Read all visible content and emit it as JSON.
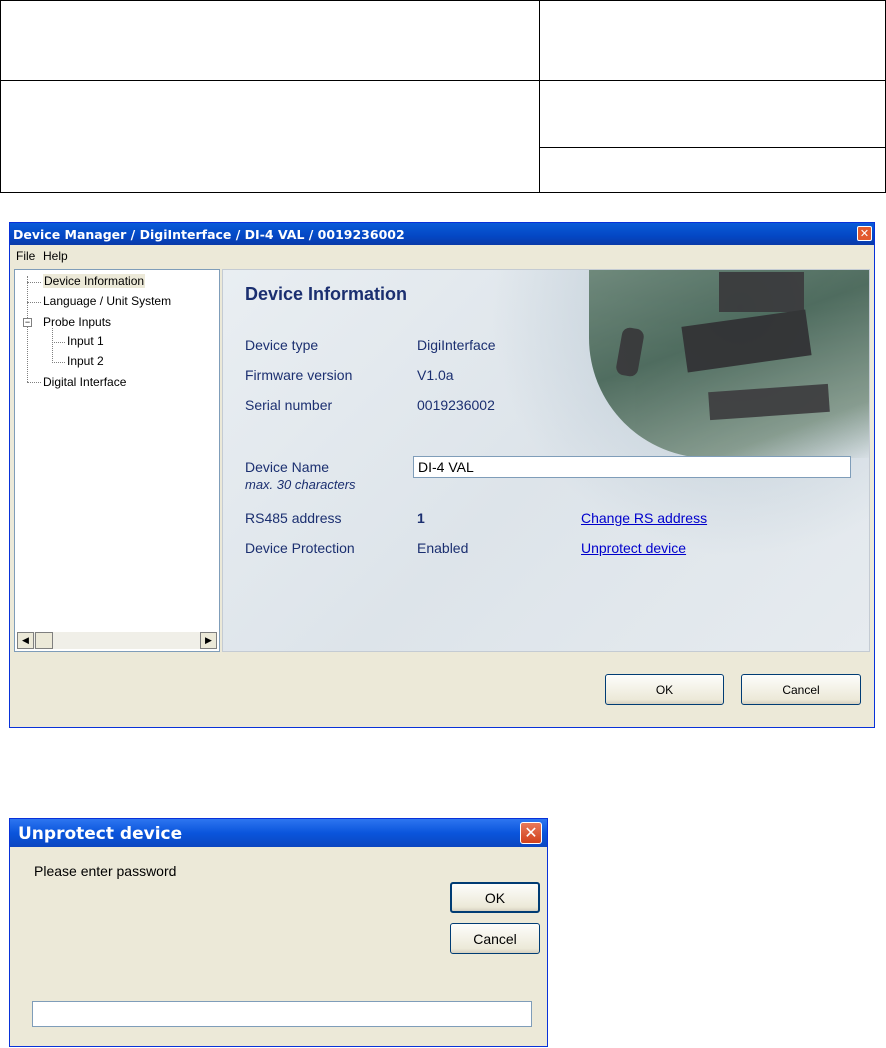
{
  "window": {
    "title": "Device Manager / DigiInterface / DI-4 VAL / 0019236002",
    "menu": [
      "File",
      "Help"
    ],
    "tree": {
      "items": [
        "Device Information",
        "Language / Unit System",
        "Probe Inputs",
        "Input  1",
        "Input  2",
        "Digital Interface"
      ],
      "selected": "Device Information",
      "expander": "−"
    },
    "panel": {
      "title": "Device Information",
      "device_type_label": "Device type",
      "device_type_value": "DigiInterface",
      "firmware_label": "Firmware version",
      "firmware_value": "V1.0a",
      "serial_label": "Serial number",
      "serial_value": "0019236002",
      "device_name_label": "Device Name",
      "device_name_hint": "max. 30 characters",
      "device_name_value": "DI-4 VAL",
      "rs485_label": "RS485 address",
      "rs485_value": "1",
      "change_rs_link": "Change RS address",
      "protection_label": "Device Protection",
      "protection_value": "Enabled",
      "unprotect_link": "Unprotect device"
    },
    "buttons": {
      "ok": "OK",
      "cancel": "Cancel"
    },
    "icons": {
      "close": "close-icon",
      "scroll_left": "◀",
      "scroll_right": "▶"
    }
  },
  "dialog": {
    "title": "Unprotect device",
    "prompt": "Please enter password",
    "ok": "OK",
    "cancel": "Cancel",
    "password_value": "",
    "close_glyph": "✕"
  },
  "colors": {
    "title_blue": "#0a5bd8",
    "label_navy": "#1b2f70",
    "link_blue": "#0000cc",
    "close_red": "#e25a2e"
  }
}
